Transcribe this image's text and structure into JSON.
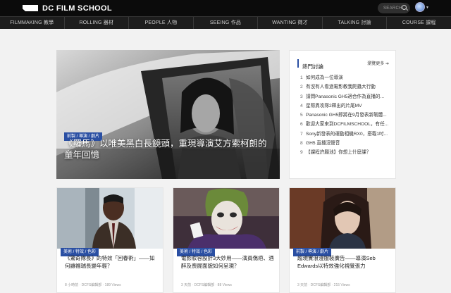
{
  "header": {
    "logo_text": "DC FILM SCHOOL",
    "search_label": "SEARCH"
  },
  "nav": [
    {
      "label": "FILMMAKING 教學"
    },
    {
      "label": "ROLLING 器材"
    },
    {
      "label": "PEOPLE 人物"
    },
    {
      "label": "SEEING 作品"
    },
    {
      "label": "WANTING 徵才"
    },
    {
      "label": "TALKING 討論"
    },
    {
      "label": "COURSE 課程"
    }
  ],
  "hero": {
    "badge": "前製 / 導演 / 劇片",
    "title": "《羅馬》以唯美黑白長鏡頭，重現導演艾方索柯朗的童年回憶",
    "dots_total": 10,
    "active_dot": 4
  },
  "sidebar": {
    "title": "熱門討論",
    "more": "瀏覽更多",
    "items": [
      {
        "num": "1",
        "text": "如何成為一位導演"
      },
      {
        "num": "2",
        "text": "有沒有人看過電影教我爬蟲大行動"
      },
      {
        "num": "3",
        "text": "請問Panasonic GH5適合作為直播的..."
      },
      {
        "num": "4",
        "text": "星際異攻隊2釋出的片尾MV"
      },
      {
        "num": "5",
        "text": "Panasonic GH5即將在9月發表新韌體..."
      },
      {
        "num": "6",
        "text": "歡迎大家來到DCFILMSCHOOL，有任..."
      },
      {
        "num": "7",
        "text": "Sony新發表的運動相機RX0，搭載1吋..."
      },
      {
        "num": "8",
        "text": "GH5 直播沒聲音"
      },
      {
        "num": "9",
        "text": "【課程許願池】你想上什麼課？"
      }
    ]
  },
  "cards": [
    {
      "badge": "美術 / 特效 / 色彩",
      "title": "《驚奇隊長》的特效「回春術」——如何讓福瑞長變年輕？",
      "meta": "8 小時前 · DCFS編輯部 · 189 Views"
    },
    {
      "badge": "美術 / 特效 / 色彩",
      "title": "電影妝容設計3大妙用——演員傷疤、酒醉及喪屍面貌如何呈現？",
      "meta": "3 天前 · DCFS編輯部 · 88 Views"
    },
    {
      "badge": "前製 / 導演 / 劇片",
      "title": "超現實浪漫服裝廣告——導演Seb Edwards以特效強化視覺張力",
      "meta": "3 天前 · DCFS編輯部 · 215 Views"
    }
  ],
  "colors": {
    "accent": "#2a4fa3",
    "topbar": "#0b0b0b",
    "navbar": "#1d1d1d",
    "page_bg": "#f2f2f2"
  }
}
